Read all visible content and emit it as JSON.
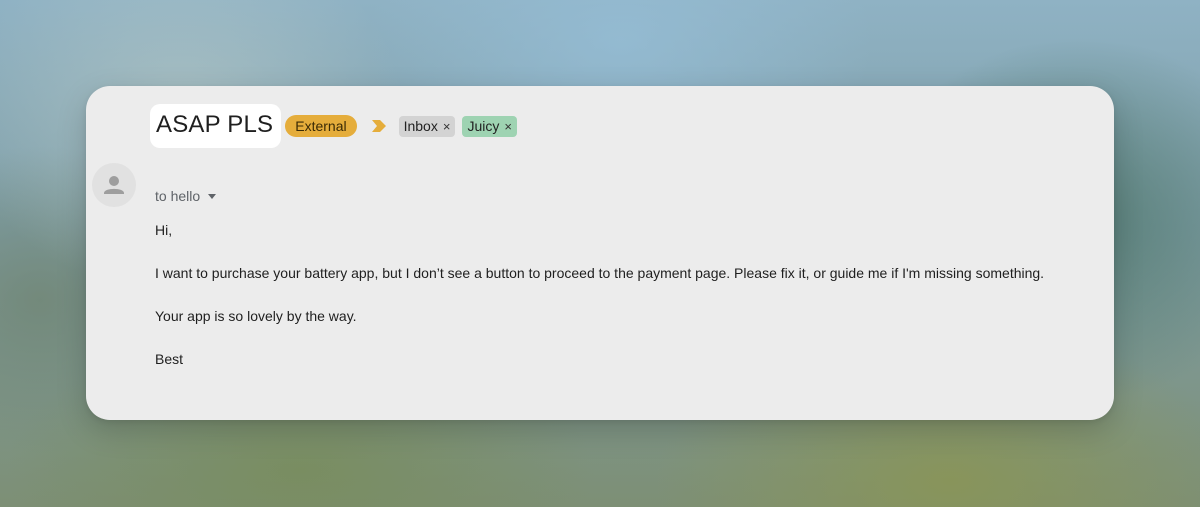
{
  "email": {
    "subject": "ASAP PLS",
    "external_tag": "External",
    "labels": [
      {
        "name": "Inbox",
        "remove": "×",
        "color": "#d3d3d3"
      },
      {
        "name": "Juicy",
        "remove": "×",
        "color": "#9ed3b2"
      }
    ],
    "importance_icon": "importance-marker-icon",
    "avatar_icon": "person-icon",
    "recipient_line": "to hello",
    "recipient_dropdown_icon": "caret-down-icon",
    "body": {
      "greeting": "Hi,",
      "paragraph1": "I want to purchase your battery app, but I don’t see a button to proceed to the payment page. Please fix it, or guide me if I'm missing something.",
      "paragraph2": "Your app is so lovely by the way.",
      "signoff": "Best"
    }
  },
  "colors": {
    "external_tag": "#e5ad3b",
    "importance_marker": "#e5ad3b",
    "card_background": "#ececec"
  }
}
